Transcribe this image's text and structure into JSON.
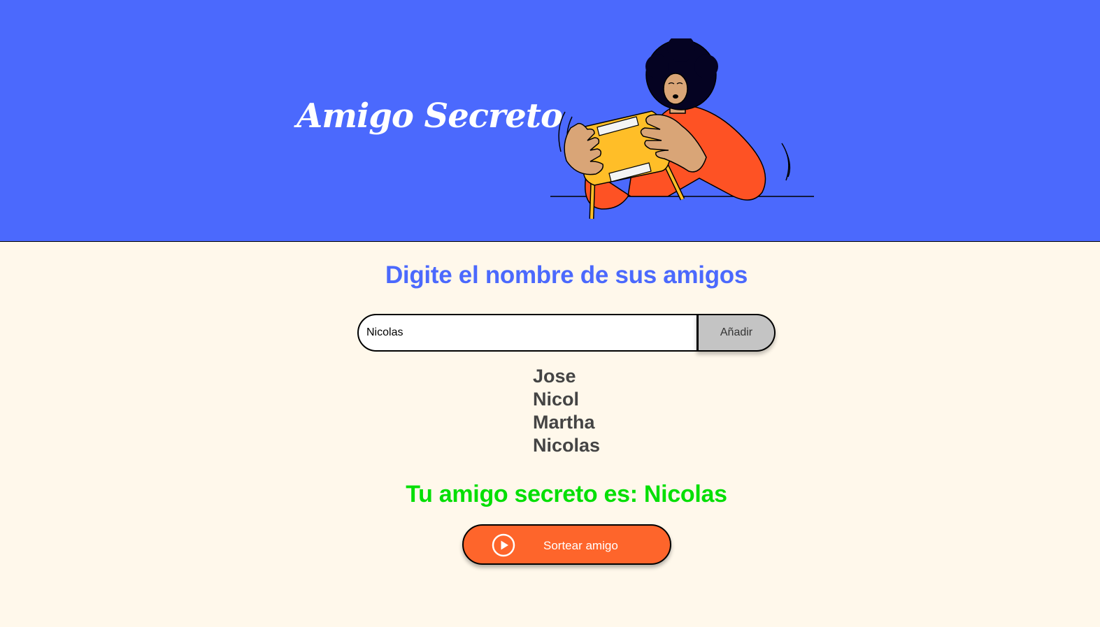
{
  "header": {
    "title": "Amigo Secreto",
    "background_color": "#4B69FD",
    "illustration_icon": "person-holding-gift-icon"
  },
  "main": {
    "background_color": "#FFF8EB",
    "heading": "Digite el nombre de sus amigos",
    "input": {
      "value": "Nicolas",
      "placeholder": ""
    },
    "add_button_label": "Añadir",
    "friends": [
      "Jose",
      "Nicol",
      "Martha",
      "Nicolas"
    ],
    "result_text": "Tu amigo secreto es: Nicolas",
    "result_color": "#05DF05",
    "draw_button_label": "Sortear amigo",
    "draw_button_icon": "play-circle-icon",
    "draw_button_color": "#FE652B"
  }
}
